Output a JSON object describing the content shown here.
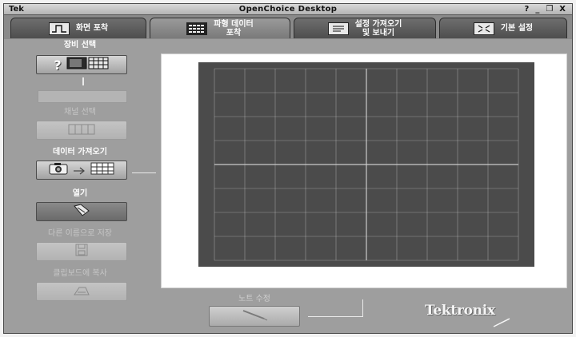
{
  "window": {
    "logo": "Tek",
    "title": "OpenChoice Desktop",
    "controls": {
      "help": "?",
      "minimize": "_",
      "restore": "❐",
      "close": "X"
    }
  },
  "tabs": [
    {
      "label": "화면 포착",
      "icon": "waveform-icon",
      "active": false
    },
    {
      "label": "파형 데이터\n포착",
      "icon": "data-grid-icon",
      "active": true
    },
    {
      "label": "설정 가져오기\n및 보내기",
      "icon": "settings-file-icon",
      "active": false
    },
    {
      "label": "기본 설정",
      "icon": "preferences-icon",
      "active": false
    }
  ],
  "sidebar": {
    "select_device": {
      "label": "장비 선택",
      "button_text": "?"
    },
    "select_channel": {
      "label": "채널 선택"
    },
    "get_data": {
      "label": "데이터 가져오기"
    },
    "open": {
      "label": "열기"
    },
    "save_as": {
      "label": "다른 이름으로 저장"
    },
    "copy_clipboard": {
      "label": "클립보드에 복사"
    }
  },
  "notes": {
    "label": "노트 수정"
  },
  "brand": "Tektronix",
  "colors": {
    "frame": "#9e9e9e",
    "tab": "#5a5a5a",
    "screen": "#4b4b4b",
    "grid": "#d8d8d8"
  }
}
